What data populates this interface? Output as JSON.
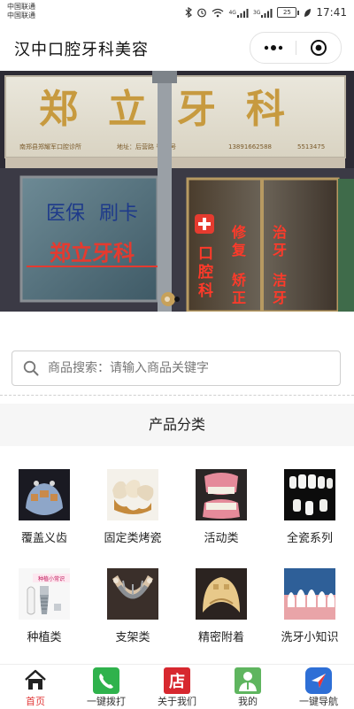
{
  "status_bar": {
    "carrier_1": "中国联通",
    "carrier_2": "中国联通",
    "battery": "25",
    "time": "17:41",
    "network_1": "4G",
    "network_2": "3G"
  },
  "header": {
    "title": "汉中口腔牙科美容"
  },
  "banner": {
    "sign_title": "郑立牙科",
    "sign_subline_1": "南郑县郑耀军口腔诊所",
    "sign_subline_2": "地址：后营路 号26号",
    "sign_phone": "13891662588",
    "sign_phone_2": "5513475",
    "window_left_1": "医保",
    "window_left_2": "刷卡",
    "window_left_red": "郑立牙科",
    "door_red_1": "口腔科",
    "door_red_2": "修复",
    "door_red_3": "矫正",
    "door_red_4": "治牙",
    "door_red_5": "洁牙",
    "slide_count": 2,
    "active_slide": 2
  },
  "search": {
    "placeholder": "商品搜索：请输入商品关键字"
  },
  "categories": {
    "title": "产品分类",
    "items": [
      {
        "label": "覆盖义齿",
        "icon": "overdenture-image"
      },
      {
        "label": "固定类烤瓷",
        "icon": "porcelain-crown-image"
      },
      {
        "label": "活动类",
        "icon": "removable-denture-image"
      },
      {
        "label": "全瓷系列",
        "icon": "all-ceramic-image"
      },
      {
        "label": "种植类",
        "icon": "implant-image"
      },
      {
        "label": "支架类",
        "icon": "framework-image"
      },
      {
        "label": "精密附着",
        "icon": "precision-attachment-image"
      },
      {
        "label": "洗牙小知识",
        "icon": "teeth-cleaning-image"
      }
    ],
    "implant_caption": "种植小常识"
  },
  "tabbar": {
    "items": [
      {
        "label": "首页",
        "icon": "home-icon",
        "active": true
      },
      {
        "label": "一键拨打",
        "icon": "phone-icon",
        "active": false
      },
      {
        "label": "关于我们",
        "icon": "store-icon",
        "active": false
      },
      {
        "label": "我的",
        "icon": "user-icon",
        "active": false
      },
      {
        "label": "一键导航",
        "icon": "navigation-icon",
        "active": false
      }
    ],
    "store_glyph": "店"
  },
  "colors": {
    "active_tab": "#e23a3a",
    "phone_green": "#2fb24c",
    "store_red": "#d7282f",
    "user_green": "#5fb55f",
    "nav_blue": "#2e6fd6"
  }
}
